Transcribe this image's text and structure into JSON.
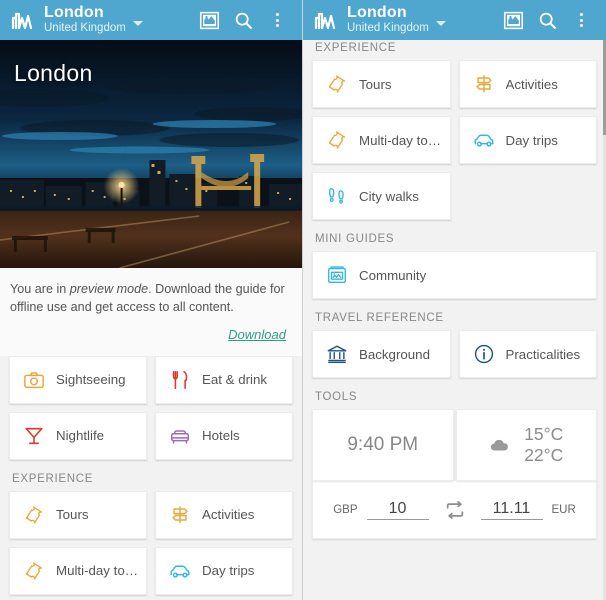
{
  "colors": {
    "appbar": "#4FA6CE",
    "link": "#2E9E87",
    "orange": "#E8A93C",
    "red": "#D9372F",
    "purple": "#9B6BC4",
    "cyan": "#35B7E0",
    "navy": "#1F4E8C",
    "text": "#555555",
    "section": "#878787"
  },
  "appbar": {
    "logo_icon": "mountain-chart-logo-icon",
    "city": "London",
    "country": "United Kingdom",
    "caret_icon": "chevron-down-icon",
    "map_icon": "map-globe-icon",
    "search_icon": "search-icon",
    "overflow_icon": "overflow-menu-icon"
  },
  "hero": {
    "title": "London",
    "image_alt": "london-night-skyline-tower-bridge"
  },
  "preview": {
    "text_before": "You are in ",
    "emphasis": "preview mode",
    "text_after": ". Download the guide for offline use and get access to all content.",
    "download_label": "Download"
  },
  "sections": {
    "explore_tiles": [
      {
        "label": "Sightseeing",
        "icon": "camera-icon",
        "color": "#E8A93C"
      },
      {
        "label": "Eat & drink",
        "icon": "cutlery-icon",
        "color": "#D9372F"
      },
      {
        "label": "Nightlife",
        "icon": "cocktail-icon",
        "color": "#D9372F"
      },
      {
        "label": "Hotels",
        "icon": "bed-icon",
        "color": "#9B6BC4"
      }
    ],
    "experience_header": "EXPERIENCE",
    "experience_tiles": [
      {
        "label": "Tours",
        "icon": "ticket-icon",
        "color": "#E8A93C"
      },
      {
        "label": "Activities",
        "icon": "signpost-icon",
        "color": "#E8A93C"
      },
      {
        "label": "Multi-day to…",
        "icon": "ticket-icon",
        "color": "#E8A93C"
      },
      {
        "label": "Day trips",
        "icon": "car-icon",
        "color": "#35B7E0"
      },
      {
        "label": "City walks",
        "icon": "footprints-icon",
        "color": "#35B7E0"
      }
    ],
    "mini_guides_header": "MINI GUIDES",
    "mini_guides_tiles": [
      {
        "label": "Community",
        "icon": "newspaper-icon",
        "color": "#35B7E0"
      }
    ],
    "travel_reference_header": "TRAVEL REFERENCE",
    "travel_reference_tiles": [
      {
        "label": "Background",
        "icon": "museum-icon",
        "color": "#1F4E8C"
      },
      {
        "label": "Practicalities",
        "icon": "info-icon",
        "color": "#1F4E8C"
      }
    ],
    "tools_header": "TOOLS"
  },
  "tools": {
    "clock_time": "9:40 PM",
    "weather_icon": "cloud-icon",
    "temp_low": "15°C",
    "temp_high": "22°C",
    "currency_from_code": "GBP",
    "currency_from_value": "10",
    "swap_icon": "swap-arrows-icon",
    "currency_to_value": "11.11",
    "currency_to_code": "EUR"
  }
}
